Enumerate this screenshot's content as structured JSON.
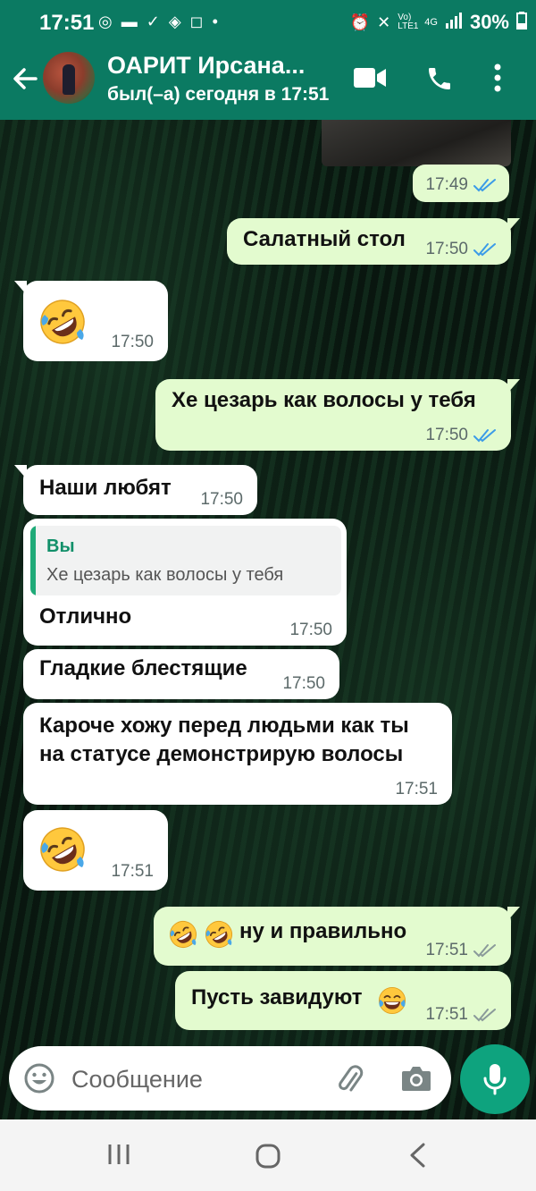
{
  "status_bar": {
    "time": "17:51",
    "battery": "30%",
    "network": "4G",
    "volte": "Vo) LTE1"
  },
  "header": {
    "contact_name": "ОАРИТ Ирсана...",
    "last_seen": "был(–а) сегодня в 17:51"
  },
  "messages": [
    {
      "direction": "out",
      "text": "",
      "time": "17:49",
      "status": "read"
    },
    {
      "direction": "out",
      "text": "Салатный стол",
      "time": "17:50",
      "status": "read"
    },
    {
      "direction": "in",
      "emoji": "rofl",
      "time": "17:50"
    },
    {
      "direction": "out",
      "text": "Хе цезарь как волосы у тебя",
      "time": "17:50",
      "status": "read"
    },
    {
      "direction": "in",
      "text": "Наши любят",
      "time": "17:50"
    },
    {
      "direction": "in",
      "quote_author": "Вы",
      "quote_text": "Хе цезарь как волосы у тебя",
      "text": "Отлично",
      "time": "17:50"
    },
    {
      "direction": "in",
      "text": "Гладкие блестящие",
      "time": "17:50"
    },
    {
      "direction": "in",
      "text_line1": "Кароче хожу перед людьми как ты",
      "text_line2": "на статусе демонстрирую волосы",
      "time": "17:51"
    },
    {
      "direction": "in",
      "emoji": "rofl",
      "time": "17:51"
    },
    {
      "direction": "out",
      "text": "ну и правильно",
      "time": "17:51",
      "status": "delivered"
    },
    {
      "direction": "out",
      "text": "Пусть завидуют",
      "time": "17:51",
      "status": "delivered"
    }
  ],
  "composer": {
    "placeholder": "Сообщение"
  },
  "colors": {
    "header": "#0b7a62",
    "outgoing_bubble": "#e3fbcf",
    "incoming_bubble": "#ffffff",
    "read_ticks": "#3b9be8",
    "fab": "#0ea37e"
  }
}
